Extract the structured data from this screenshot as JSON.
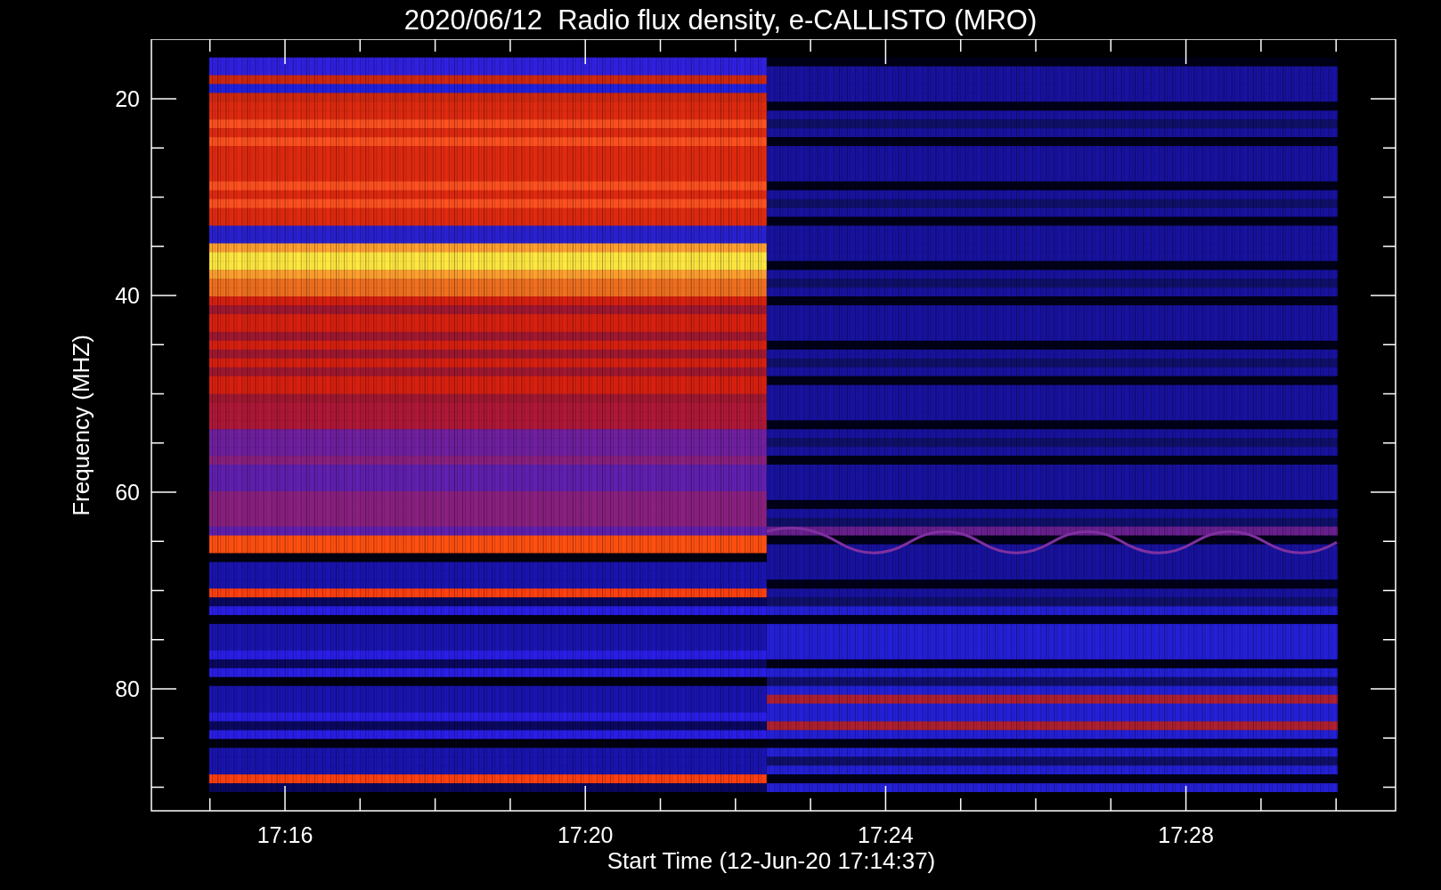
{
  "title": "2020/06/12  Radio flux density, e-CALLISTO (MRO)",
  "y_axis": {
    "label": "Frequency (MHZ)",
    "ticks": [
      "20",
      "40",
      "60",
      "80"
    ]
  },
  "x_axis": {
    "label": "Start Time (12-Jun-20 17:14:37)",
    "ticks": [
      "17:16",
      "17:20",
      "17:24",
      "17:28"
    ]
  }
}
